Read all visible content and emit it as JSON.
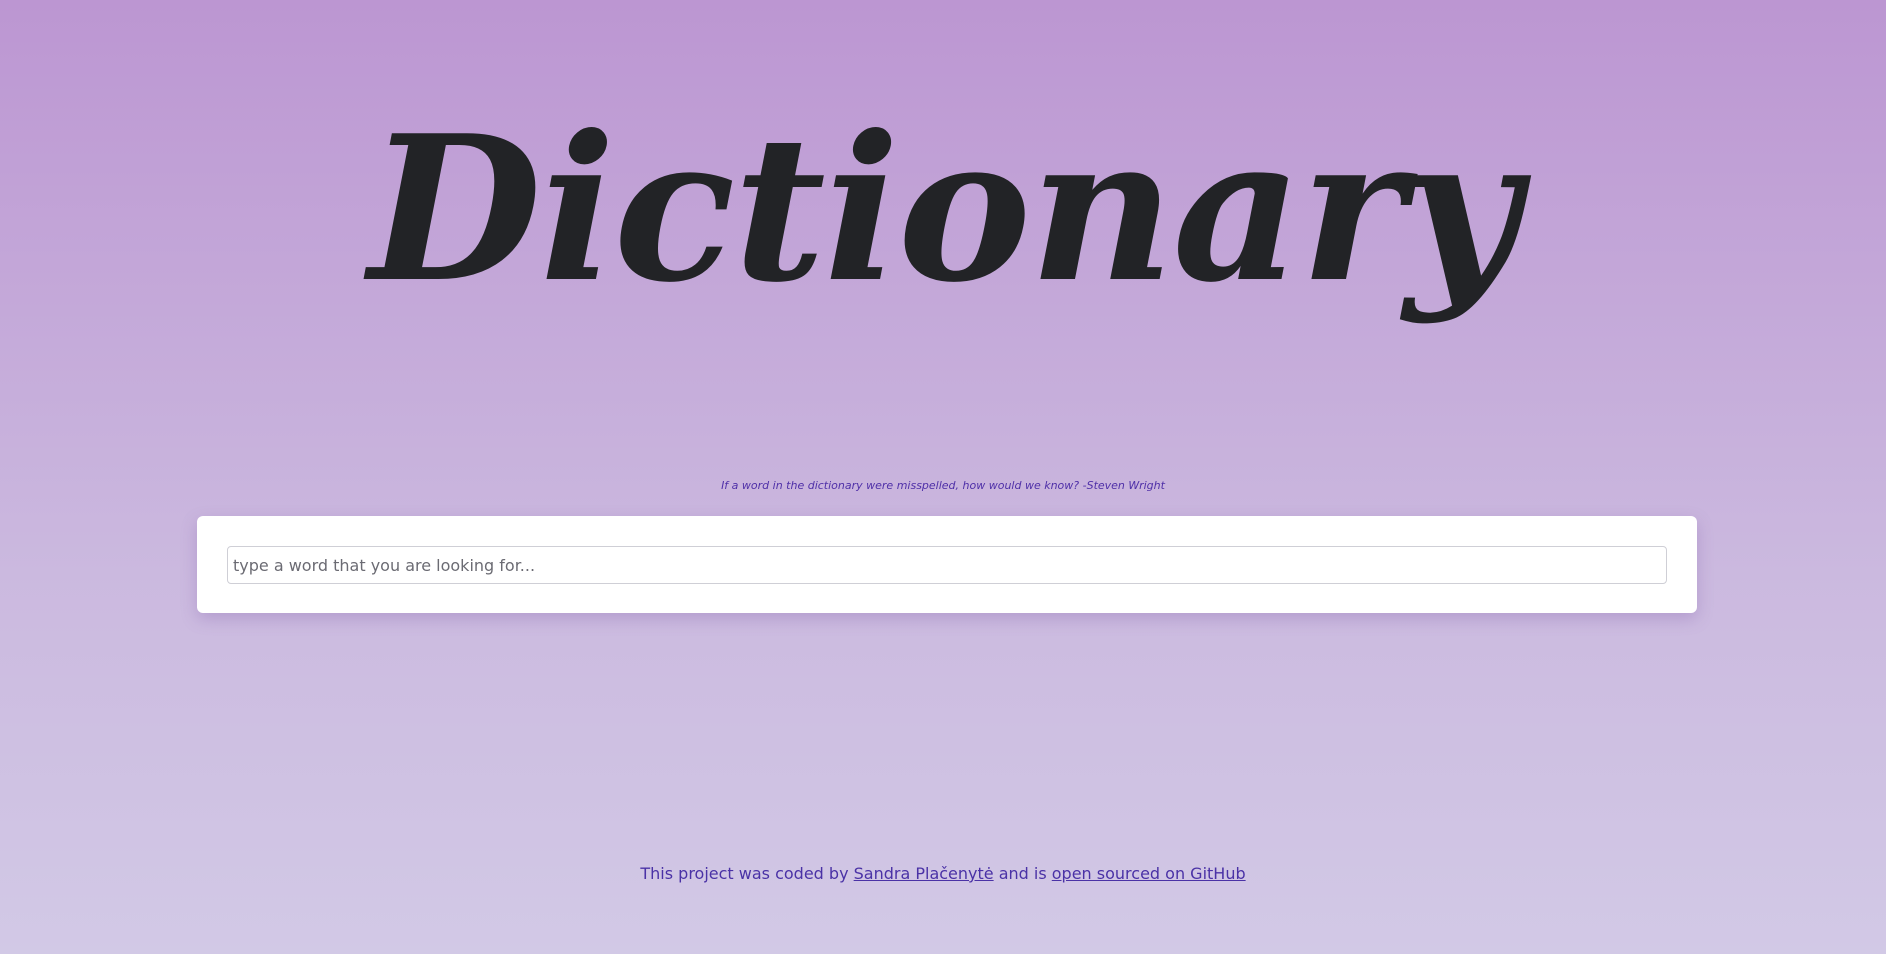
{
  "header": {
    "title": "Dictionary"
  },
  "quote": {
    "text": "If a word in the dictionary were misspelled, how would we know? -Steven Wright"
  },
  "search": {
    "placeholder": "type a word that you are looking for...",
    "value": ""
  },
  "footer": {
    "prefix": "This project was coded by ",
    "author_link": "Sandra Plačenytė",
    "middle": " and is ",
    "github_link": "open sourced on GitHub"
  },
  "colors": {
    "background_top": "#bc96d2",
    "background_bottom": "#d2c9e6",
    "title_text": "#222326",
    "accent_text": "#4a32a6",
    "card_background": "#ffffff"
  }
}
